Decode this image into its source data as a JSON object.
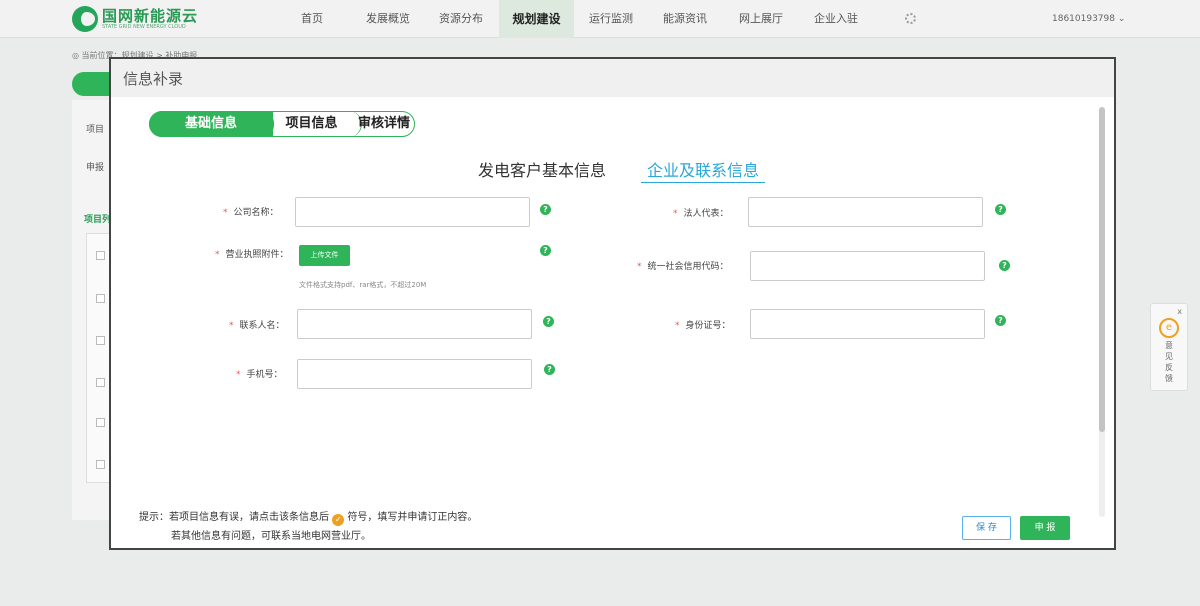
{
  "nav": {
    "logo_text": "国网新能源云",
    "logo_sub": "STATE GRID NEW ENERGY CLOUD",
    "items": [
      "首页",
      "发展概览",
      "资源分布",
      "规划建设",
      "运行监测",
      "能源资讯",
      "网上展厅",
      "企业入驻"
    ],
    "active_index": 3,
    "user": "18610193798 ⌄"
  },
  "background": {
    "breadcrumb": "◎ 当前位置：规划建设 > 补助申报",
    "label_project": "项目",
    "label_report": "申报",
    "label_project_list": "项目列"
  },
  "feedback": {
    "close": "x",
    "label": "意见反馈"
  },
  "modal": {
    "title": "信息补录",
    "steps": [
      "基础信息",
      "项目信息",
      "审核详情"
    ],
    "section_tabs": [
      "发电客户基本信息",
      "企业及联系信息"
    ],
    "active_section": 1,
    "fields": {
      "company_name": {
        "label": "公司名称：",
        "value": ""
      },
      "legal_rep": {
        "label": "法人代表：",
        "value": ""
      },
      "license": {
        "label": "营业执照附件：",
        "upload": "上传文件",
        "hint": "文件格式支持pdf、rar格式，不超过20M"
      },
      "credit_code": {
        "label": "统一社会信用代码：",
        "value": ""
      },
      "contact": {
        "label": "联系人名：",
        "value": ""
      },
      "id_number": {
        "label": "身份证号：",
        "value": ""
      },
      "phone": {
        "label": "手机号：",
        "value": ""
      }
    },
    "required_mark": "*",
    "help_mark": "?",
    "tip_line1_a": "提示：若项目信息有误，请点击该条信息后",
    "tip_icon": "✓",
    "tip_line1_b": "符号，填写并申请订正内容。",
    "tip_line2": "若其他信息有问题，可联系当地电网营业厅。",
    "save_label": "保 存",
    "submit_label": "申 报"
  }
}
